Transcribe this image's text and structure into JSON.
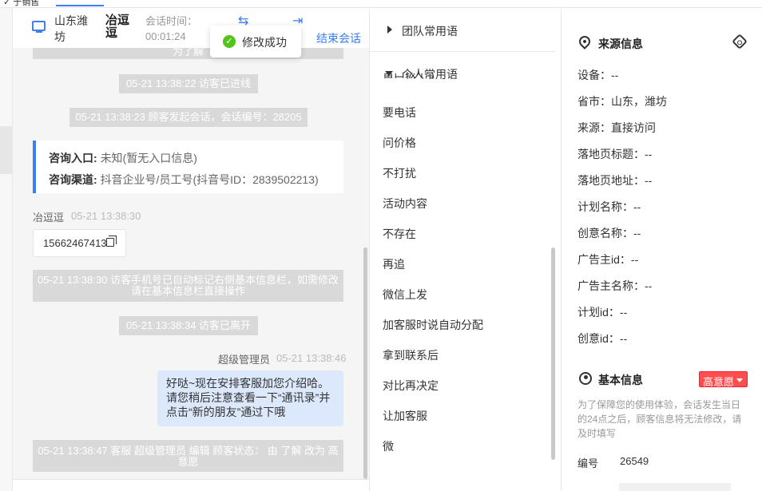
{
  "window": {
    "top_cut_left": "✓ 于销售",
    "top_cut_right": "..."
  },
  "chat": {
    "location": "山东潍坊",
    "visitor": "冶逗逗",
    "time_label": "会话时间：",
    "time_value": "00:01:24",
    "end_label": "结束会话",
    "toast": "修改成功",
    "messages": {
      "sys_cut": "为了解",
      "sys1": "05-21 13:38:22 访客已进线",
      "sys2": "05-21 13:38:23 顾客发起会话，会话编号：28205",
      "entry_label": "咨询入口:",
      "entry_value": "未知(暂无入口信息)",
      "channel_label": "咨询渠道:",
      "channel_value": "抖音企业号/员工号(抖音号ID：2839502213)",
      "visitor_sender": "冶逗逗",
      "visitor_time": "05-21 13:38:30",
      "phone": "15662467413",
      "sys3": "05-21 13:38:30 访客手机号已自动标记右侧基本信息栏，如需修改请在基本信息栏直接操作",
      "sys4": "05-21 13:38:34 访客已离开",
      "admin_sender": "超级管理员",
      "admin_time": "05-21 13:38:46",
      "bubble": "好哒~现在安排客服加您介绍哈。请您稍后注意查看一下“通讯录”并点击“新的朋友”通过下哦",
      "sys5": "05-21 13:38:47 客服 超级管理员 编辑 顾客状态： 由 了解 改为 高意愿"
    }
  },
  "phrases": {
    "team_title": "团队常用语",
    "personal_title": "个人常用语",
    "cut_item": "留口级不了",
    "items": [
      "要电话",
      "问价格",
      "不打扰",
      "活动内容",
      "不存在",
      "再追",
      "微信上发",
      "加客服时说自动分配",
      "拿到联系后",
      "对比再决定",
      "让加客服",
      "微"
    ]
  },
  "info": {
    "source_title": "来源信息",
    "fields": [
      {
        "label": "设备：",
        "value": "--"
      },
      {
        "label": "省市：",
        "value": "山东，潍坊"
      },
      {
        "label": "来源：",
        "value": "直接访问"
      },
      {
        "label": "落地页标题：",
        "value": "--"
      },
      {
        "label": "落地页地址：",
        "value": "--"
      },
      {
        "label": "计划名称：",
        "value": "--"
      },
      {
        "label": "创意名称：",
        "value": "--"
      },
      {
        "label": "广告主id：",
        "value": "--"
      },
      {
        "label": "广告主名称：",
        "value": "--"
      },
      {
        "label": "计划id：",
        "value": "--"
      },
      {
        "label": "创意id：",
        "value": "--"
      }
    ],
    "basic_title": "基本信息",
    "intent": "高意愿",
    "notice": "为了保障您的使用体验，会话发生当日的24点之后，顾客信息将无法修改，请及时填写",
    "number_label": "编号",
    "number_value": "26549"
  },
  "colors": {
    "accent": "#3b7ff3",
    "sys_bg": "#d9d9d9",
    "bubble_bg": "#dce8fb",
    "badge": "#ff4d4f",
    "success": "#52c41a"
  }
}
